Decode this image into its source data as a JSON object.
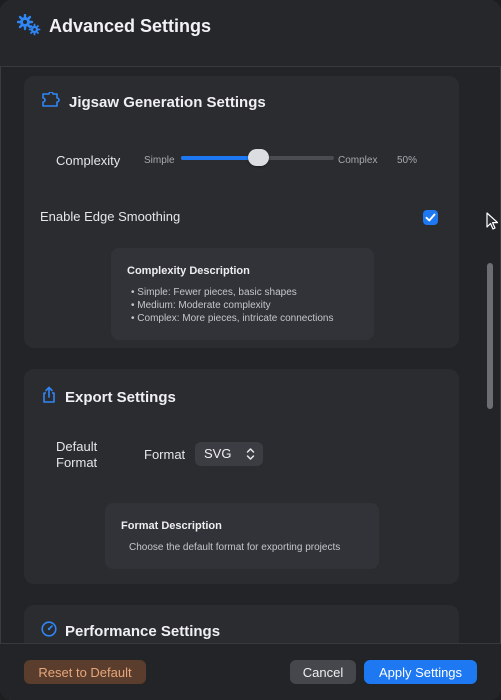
{
  "window": {
    "title": "Advanced Settings",
    "title_icon": "gears-icon"
  },
  "jigsaw": {
    "title": "Jigsaw Generation Settings",
    "icon": "puzzle-piece-icon",
    "complexity_label": "Complexity",
    "slider_min_label": "Simple",
    "slider_max_label": "Complex",
    "slider_value": 50,
    "slider_value_text": "50%",
    "edge_smoothing_label": "Enable Edge Smoothing",
    "edge_smoothing_checked": true,
    "description": {
      "title": "Complexity Description",
      "lines": [
        "• Simple: Fewer pieces, basic shapes",
        "• Medium: Moderate complexity",
        "• Complex: More pieces, intricate connections"
      ]
    }
  },
  "export": {
    "title": "Export Settings",
    "icon": "share-icon",
    "default_format_label_line1": "Default",
    "default_format_label_line2": "Format",
    "format_label": "Format",
    "format_value": "SVG",
    "description": {
      "title": "Format Description",
      "text": "Choose the default format for exporting projects"
    }
  },
  "performance": {
    "title": "Performance Settings",
    "icon": "gauge-icon"
  },
  "footer": {
    "reset_label": "Reset to Default",
    "cancel_label": "Cancel",
    "apply_label": "Apply Settings"
  },
  "colors": {
    "accent": "#1d78f2",
    "reset_bg": "#5a3d2c",
    "reset_text": "#e8a67a",
    "window_bg": "#222427",
    "card_bg": "#2a2c30"
  }
}
